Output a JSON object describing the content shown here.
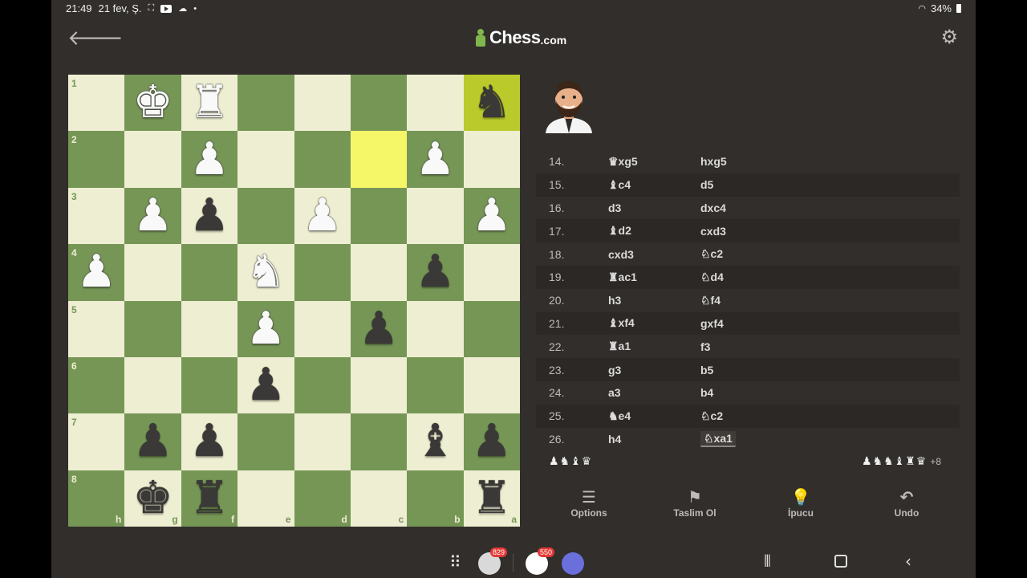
{
  "status": {
    "time": "21:49",
    "date": "21 fev, Ş.",
    "battery": "34%"
  },
  "header": {
    "logo_name": "Chess",
    "logo_tld": ".com",
    "back_glyph": "🡐",
    "settings_glyph": "⚙"
  },
  "board": {
    "files": [
      "h",
      "g",
      "f",
      "e",
      "d",
      "c",
      "b",
      "a"
    ],
    "ranks": [
      "1",
      "2",
      "3",
      "4",
      "5",
      "6",
      "7",
      "8"
    ],
    "rows": [
      [
        null,
        "wK",
        "wR",
        null,
        null,
        null,
        null,
        "bN"
      ],
      [
        null,
        null,
        "wP",
        null,
        null,
        null,
        "wP",
        null
      ],
      [
        null,
        "wP",
        "bP",
        null,
        "wP",
        null,
        null,
        "wP"
      ],
      [
        "wP",
        null,
        null,
        "wN",
        null,
        null,
        "bP",
        null
      ],
      [
        null,
        null,
        null,
        "wP",
        null,
        "bP",
        null,
        null
      ],
      [
        null,
        null,
        null,
        "bP",
        null,
        null,
        null,
        null
      ],
      [
        null,
        "bP",
        "bP",
        null,
        null,
        null,
        "bB",
        "bP"
      ],
      [
        null,
        "bK",
        "bR",
        null,
        null,
        null,
        null,
        "bR"
      ]
    ],
    "highlights": [
      "1-7",
      "2-5"
    ]
  },
  "moves": [
    {
      "n": "14.",
      "w": "♛xg5",
      "b": "hxg5"
    },
    {
      "n": "15.",
      "w": "♝c4",
      "b": "d5"
    },
    {
      "n": "16.",
      "w": "d3",
      "b": "dxc4"
    },
    {
      "n": "17.",
      "w": "♝d2",
      "b": "cxd3"
    },
    {
      "n": "18.",
      "w": "cxd3",
      "b": "♘c2"
    },
    {
      "n": "19.",
      "w": "♜ac1",
      "b": "♘d4"
    },
    {
      "n": "20.",
      "w": "h3",
      "b": "♘f4"
    },
    {
      "n": "21.",
      "w": "♝xf4",
      "b": "gxf4"
    },
    {
      "n": "22.",
      "w": "♜a1",
      "b": "f3"
    },
    {
      "n": "23.",
      "w": "g3",
      "b": "b5"
    },
    {
      "n": "24.",
      "w": "a3",
      "b": "b4"
    },
    {
      "n": "25.",
      "w": "♞e4",
      "b": "♘c2"
    },
    {
      "n": "26.",
      "w": "h4",
      "b": "♘xa1"
    }
  ],
  "captured": {
    "left": "♟♞♝♛",
    "right": "♟♞♞♝♜♛",
    "advantage": "+8"
  },
  "actions": [
    {
      "icon": "☰",
      "label": "Options"
    },
    {
      "icon": "⚑",
      "label": "Taslim Ol"
    },
    {
      "icon": "💡",
      "label": "İpucu"
    },
    {
      "icon": "↶",
      "label": "Undo"
    }
  ],
  "navbar": {
    "badge1": "829",
    "badge2": "550"
  }
}
